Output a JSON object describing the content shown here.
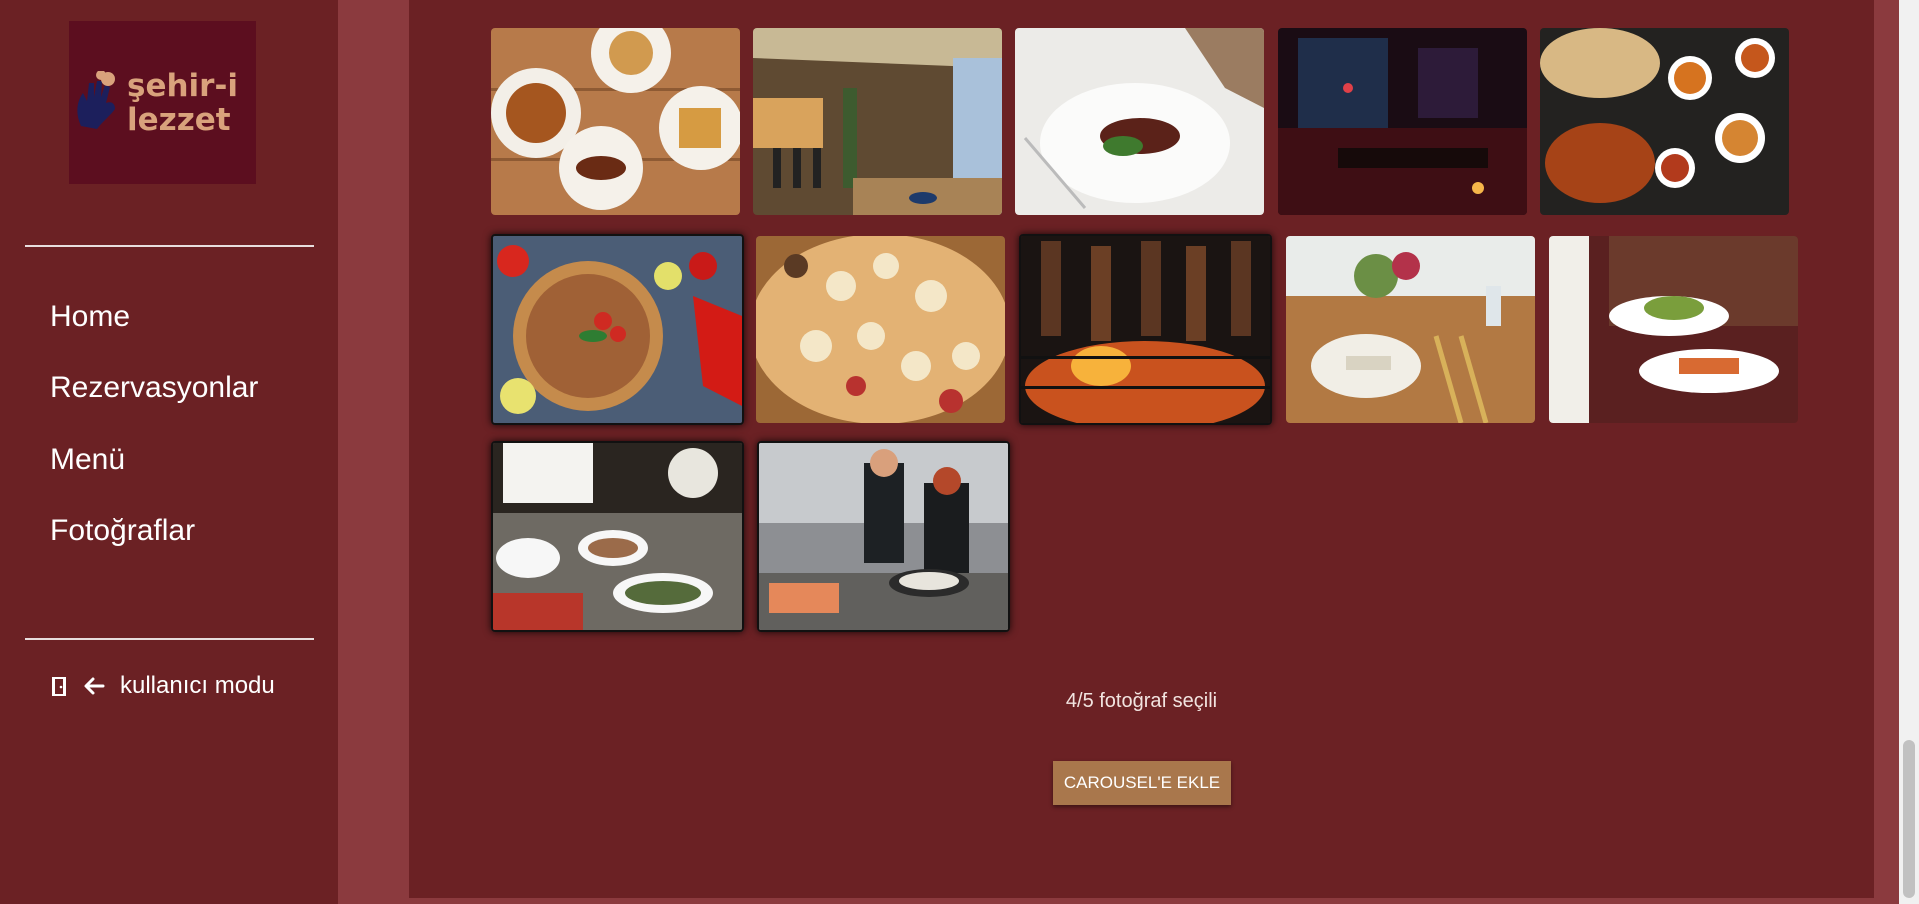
{
  "brand": {
    "line1": "şehir-i",
    "line2": "lezzet"
  },
  "nav": {
    "home": "Home",
    "reservations": "Rezervasyonlar",
    "menu": "Menü",
    "photos": "Fotoğraflar"
  },
  "user_mode": {
    "icons": [
      "door-icon",
      "arrow-left-icon"
    ],
    "label": "kullanıcı modu"
  },
  "gallery": {
    "photos": [
      {
        "name": "turkish-desserts",
        "selected": false
      },
      {
        "name": "terrace-restaurant",
        "selected": false
      },
      {
        "name": "steak-plate",
        "selected": false
      },
      {
        "name": "dining-room-night",
        "selected": false
      },
      {
        "name": "curry-spread",
        "selected": false
      },
      {
        "name": "lahmacun",
        "selected": true
      },
      {
        "name": "appetizer-board",
        "selected": false
      },
      {
        "name": "grill-skewers",
        "selected": true
      },
      {
        "name": "rustic-table-setting",
        "selected": false
      },
      {
        "name": "waiter-serving",
        "selected": false
      },
      {
        "name": "buffet-spread",
        "selected": true
      },
      {
        "name": "chefs-kitchen",
        "selected": true
      }
    ]
  },
  "selection_status": "4/5 fotoğraf seçili",
  "add_button": "CAROUSEL'E EKLE",
  "colors": {
    "sidebar_bg": "#6b2124",
    "page_bg": "#8b3a3e",
    "logo_bg": "#5c0e1f",
    "logo_text": "#d9a27c",
    "button_bg": "#a9774c"
  }
}
